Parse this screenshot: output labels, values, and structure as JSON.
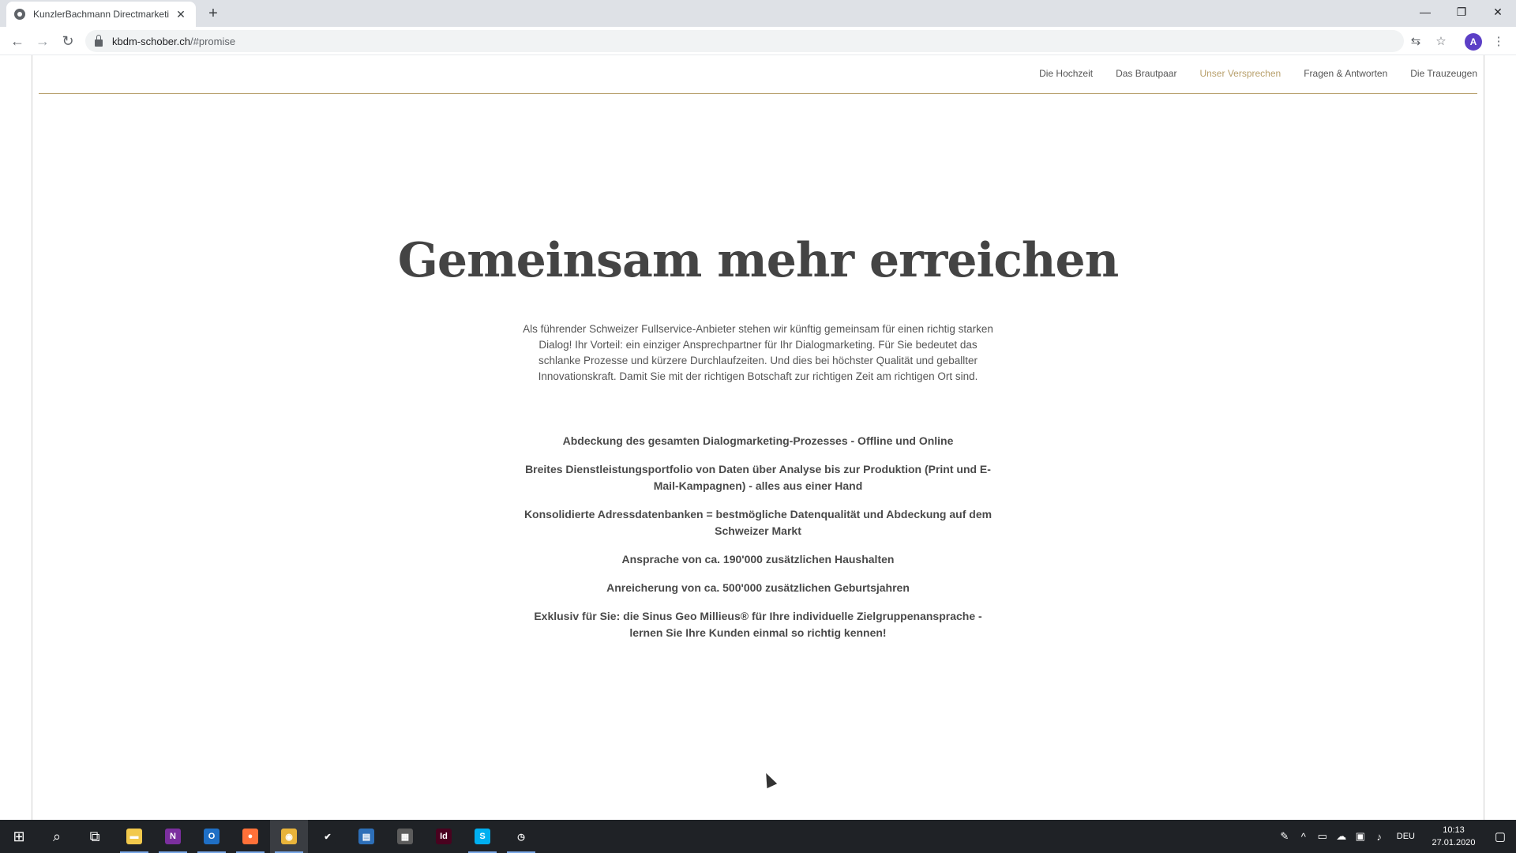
{
  "browser": {
    "tab_title": "KunzlerBachmann Directmarketi",
    "tab_close": "✕",
    "new_tab": "+",
    "url_host": "kbdm-schober.ch",
    "url_path": "/#promise",
    "avatar_letter": "A",
    "window": {
      "minimize": "—",
      "restore": "❐",
      "close": "✕"
    }
  },
  "site_nav": {
    "items": [
      {
        "label": "Die Hochzeit",
        "active": false
      },
      {
        "label": "Das Brautpaar",
        "active": false
      },
      {
        "label": "Unser Versprechen",
        "active": true
      },
      {
        "label": "Fragen & Antworten",
        "active": false
      },
      {
        "label": "Die Trauzeugen",
        "active": false
      }
    ],
    "accent_color": "#b8a06c"
  },
  "promise": {
    "title": "Gemeinsam mehr erreichen",
    "intro": "Als führender Schweizer Fullservice-Anbieter stehen wir künftig gemeinsam für einen richtig starken Dialog! Ihr Vorteil: ein einziger Ansprechpartner für Ihr Dialogmarketing. Für Sie bedeutet das schlanke Prozesse und kürzere Durchlaufzeiten. Und dies bei höchster Qualität und geballter Innovationskraft. Damit Sie mit der richtigen Botschaft zur richtigen Zeit am richtigen Ort sind.",
    "points": [
      "Abdeckung des gesamten Dialogmarketing-Prozesses - Offline und Online",
      "Breites Dienstleistungsportfolio von Daten über Analyse bis zur Produktion (Print und E-Mail-Kampagnen) - alles aus einer Hand",
      "Konsolidierte Adressdatenbanken = bestmögliche Datenqualität und Abdeckung auf dem Schweizer Markt",
      "Ansprache von ca. 190'000 zusätzlichen Haushalten",
      "Anreicherung von ca. 500'000 zusätzlichen Geburtsjahren",
      "Exklusiv für Sie: die Sinus Geo Millieus® für Ihre individuelle Zielgruppenansprache - lernen Sie Ihre Kunden einmal so richtig kennen!"
    ]
  },
  "taskbar": {
    "apps": [
      {
        "name": "file-explorer",
        "glyph": "▬",
        "color": "#f2c94c",
        "running": true
      },
      {
        "name": "onenote",
        "glyph": "N",
        "color": "#7b2f9e",
        "running": true
      },
      {
        "name": "outlook",
        "glyph": "O",
        "color": "#1f6fc5",
        "running": true
      },
      {
        "name": "firefox",
        "glyph": "●",
        "color": "#ff7139",
        "running": true
      },
      {
        "name": "chrome",
        "glyph": "◉",
        "color": "#e8b33a",
        "running": true
      },
      {
        "name": "checkmark-app",
        "glyph": "✔",
        "color": "#1f2226",
        "running": false
      },
      {
        "name": "notepad",
        "glyph": "▤",
        "color": "#2d6fb8",
        "running": false
      },
      {
        "name": "calculator",
        "glyph": "▦",
        "color": "#5c5c5c",
        "running": false
      },
      {
        "name": "indesign",
        "glyph": "Id",
        "color": "#49021f",
        "running": false
      },
      {
        "name": "skype",
        "glyph": "S",
        "color": "#00aff0",
        "running": true
      },
      {
        "name": "clock-app",
        "glyph": "◷",
        "color": "#1f2226",
        "running": true
      }
    ],
    "language": "DEU",
    "time": "10:13",
    "date": "27.01.2020"
  }
}
